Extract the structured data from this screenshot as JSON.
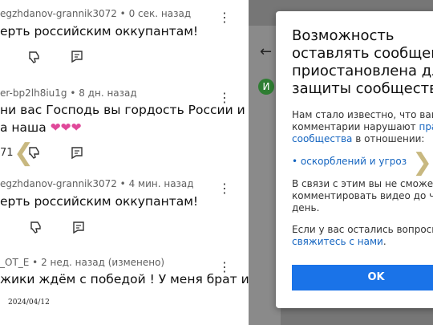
{
  "comments": [
    {
      "meta": "egzhdanov-grannik3072 • 0 сек. назад",
      "lines": [
        "ерть российским оккупантам!"
      ]
    },
    {
      "meta": "er-bp2lh8iu1g • 8 дн. назад",
      "lines": [
        "ни вас Господь вы гордость России и",
        "а наша"
      ],
      "hearts": "❤❤❤",
      "likes": "71"
    },
    {
      "meta": "egzhdanov-grannik3072 • 4 мин. назад",
      "lines": [
        "ерть российским оккупантам!"
      ]
    },
    {
      "meta": "_OT_E • 2 нед. назад (изменено)",
      "lines": [
        "жики ждём с победой ! У меня брат и"
      ]
    }
  ],
  "date_stamp": "2024/04/12",
  "icons": {
    "kebab": "more-vertical-icon",
    "dislike": "thumbs-down-icon",
    "reply": "reply-icon",
    "chevron": "chevron-icon"
  },
  "background": {
    "avatar_letter": "И"
  },
  "dialog": {
    "title_lines": [
      "Возможность",
      "оставлять сообщени",
      "приостановлена для",
      "защиты сообщества"
    ],
    "p1_line1": "Нам стало известно, что ваши",
    "p1_line2_a": "комментарии нарушают ",
    "p1_line2_link": "прав",
    "p1_line3_link": "сообщества",
    "p1_line3_b": " в отношении:",
    "bullet": "• оскорблений и угроз",
    "p2_line1": "В связи с этим вы не сможете",
    "p2_line2": "комментировать видео до чер",
    "p2_line3": "день.",
    "p3_line1": "Если у вас остались вопросы,",
    "p3_line2_link": "свяжитесь с нами",
    "p3_line2_b": ".",
    "ok": "OK"
  },
  "colors": {
    "link": "#1565c0",
    "button": "#1a73e8",
    "hearts": "#e0499a",
    "overlay": "#767676"
  }
}
